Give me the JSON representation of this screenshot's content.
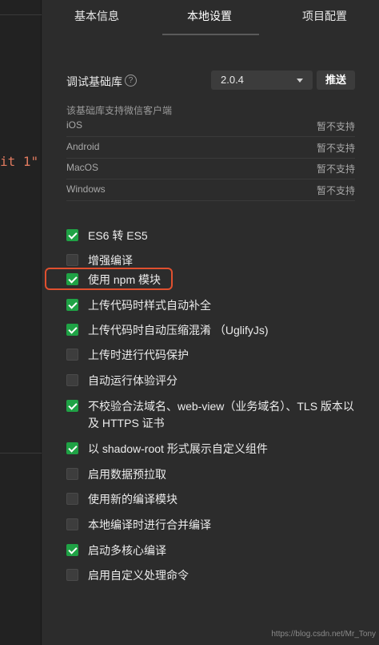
{
  "editor": {
    "code_fragment": "it 1\""
  },
  "tabs": [
    {
      "label": "基本信息"
    },
    {
      "label": "本地设置"
    },
    {
      "label": "项目配置"
    }
  ],
  "lib": {
    "label": "调试基础库",
    "help_icon": "question-circle-icon",
    "version": "2.0.4",
    "push_label": "推送",
    "support_title": "该基础库支持微信客户端",
    "clients": [
      {
        "name": "iOS",
        "status": "暂不支持"
      },
      {
        "name": "Android",
        "status": "暂不支持"
      },
      {
        "name": "MacOS",
        "status": "暂不支持"
      },
      {
        "name": "Windows",
        "status": "暂不支持"
      }
    ]
  },
  "options": [
    {
      "label": "ES6 转 ES5",
      "checked": true
    },
    {
      "label": "增强编译",
      "checked": false
    },
    {
      "label": "使用 npm 模块",
      "checked": true
    },
    {
      "label": "上传代码时样式自动补全",
      "checked": true
    },
    {
      "label": "上传代码时自动压缩混淆 （UglifyJs)",
      "checked": true
    },
    {
      "label": "上传时进行代码保护",
      "checked": false
    },
    {
      "label": "自动运行体验评分",
      "checked": false
    },
    {
      "label": "不校验合法域名、web-view（业务域名）、TLS 版本以及 HTTPS 证书",
      "checked": true
    },
    {
      "label": "以 shadow-root 形式展示自定义组件",
      "checked": true
    },
    {
      "label": "启用数据预拉取",
      "checked": false
    },
    {
      "label": "使用新的编译模块",
      "checked": false
    },
    {
      "label": "本地编译时进行合并编译",
      "checked": false
    },
    {
      "label": "启动多核心编译",
      "checked": true
    },
    {
      "label": "启用自定义处理命令",
      "checked": false
    }
  ],
  "colors": {
    "checked": "#1fa245",
    "highlight": "#e0502f"
  },
  "watermark": "https://blog.csdn.net/Mr_Tony"
}
